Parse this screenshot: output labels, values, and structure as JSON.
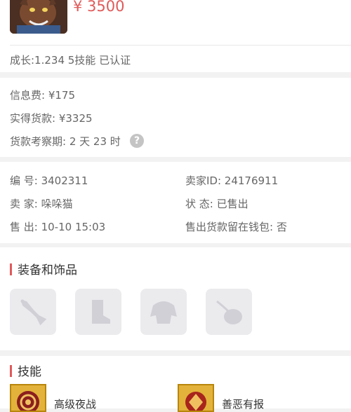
{
  "top": {
    "price": "¥ 3500",
    "growth_info": "成长:1.234 5技能 已认证"
  },
  "fees": {
    "info_fee": "信息费: ¥175",
    "actual_payment": "实得货款: ¥3325",
    "inspection_period": "货款考察期: 2 天 23 时",
    "help_icon": "?"
  },
  "info": {
    "number": "编 号:  3402311",
    "seller_id": "卖家ID:  24176911",
    "seller": "卖 家:  哚哚猫",
    "status": "状 态:  已售出",
    "sold": "售 出:  10-10 15:03",
    "wallet": "售出货款留在钱包:  否"
  },
  "equipment": {
    "title": "装备和饰品",
    "slots": [
      "weapon-slot",
      "boots-slot",
      "armor-slot",
      "accessory-slot"
    ]
  },
  "skills": {
    "title": "技能",
    "items": [
      {
        "name": "高级夜战"
      },
      {
        "name": "善恶有报"
      }
    ]
  },
  "colors": {
    "accent": "#e05a5a",
    "background": "#f2f2f2",
    "slot": "#ebebee",
    "skill": "#e3b23a"
  }
}
